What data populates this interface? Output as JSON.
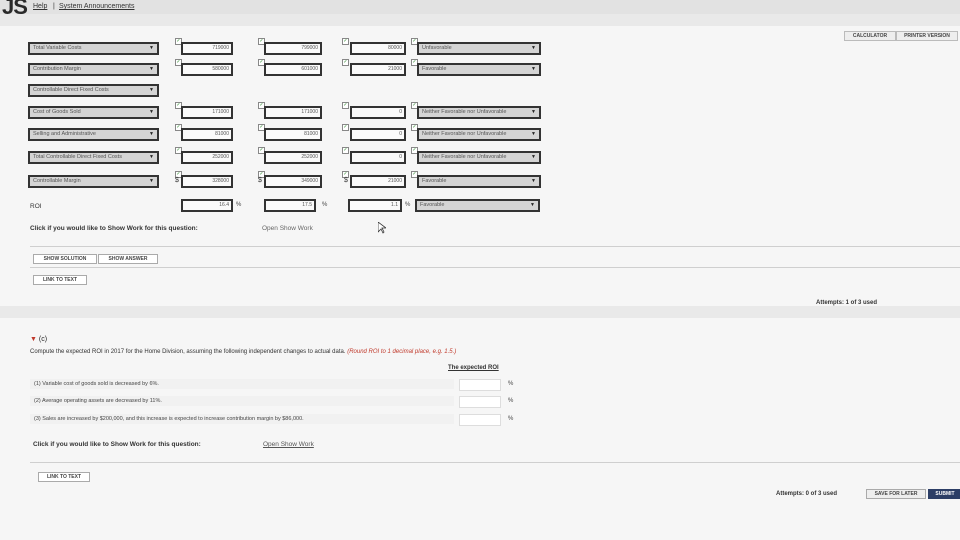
{
  "header": {
    "logo": "JS",
    "help_link": "Help",
    "separator": "|",
    "announcements_link": "System Announcements",
    "calculator_button": "CALCULATOR",
    "printer_button": "PRINTER VERSION"
  },
  "table": {
    "rows": [
      {
        "label": "Total Variable Costs",
        "v1": "719000",
        "v2": "799000",
        "v3": "80000",
        "status": "Unfavorable"
      },
      {
        "label": "Contribution Margin",
        "v1": "580000",
        "v2": "601000",
        "v3": "21000",
        "status": "Favorable"
      },
      {
        "label": "Controllable Direct Fixed Costs"
      },
      {
        "label": "Cost of Goods Sold",
        "v1": "171000",
        "v2": "171000",
        "v3": "0",
        "status": "Neither Favorable nor Unfavorable"
      },
      {
        "label": "Selling and Administrative",
        "v1": "81000",
        "v2": "81000",
        "v3": "0",
        "status": "Neither Favorable nor Unfavorable"
      },
      {
        "label": "Total Controllable Direct Fixed Costs",
        "v1": "252000",
        "v2": "252000",
        "v3": "0",
        "status": "Neither Favorable nor Unfavorable"
      },
      {
        "label": "Controllable Margin",
        "v1": "328000",
        "v2": "349000",
        "v3": "21000",
        "status": "Favorable"
      }
    ],
    "roi": {
      "label": "ROI",
      "v1": "16.4",
      "v2": "17.5",
      "v3": "1.1",
      "status": "Favorable"
    },
    "dollar": "$",
    "percent": "%"
  },
  "part_b": {
    "show_work_prompt": "Click if you would like to Show Work for this question:",
    "show_work_link": "Open Show Work",
    "show_solution": "SHOW SOLUTION",
    "show_answer": "SHOW ANSWER",
    "link_to_text": "LINK TO TEXT",
    "attempts": "Attempts: 1 of 3 used"
  },
  "part_c": {
    "toggle": "(c)",
    "instruction": "Compute the expected ROI in 2017 for the Home Division, assuming the following independent changes to actual data.",
    "rounding_note": "(Round ROI to 1 decimal place, e.g. 1.5.)",
    "column_header": "The expected ROI",
    "items": [
      {
        "text": "(1)  Variable cost of goods sold is decreased by 6%.",
        "unit": "%"
      },
      {
        "text": "(2)  Average operating assets are decreased by 11%.",
        "unit": "%"
      },
      {
        "text": "(3)  Sales are increased by $200,000, and this increase is expected to increase contribution margin by $86,000.",
        "unit": "%"
      }
    ],
    "show_work_prompt": "Click if you would like to Show Work for this question:",
    "show_work_link": "Open Show Work",
    "link_to_text": "LINK TO TEXT",
    "attempts": "Attempts: 0 of 3 used",
    "save_button": "SAVE FOR LATER",
    "submit_button": "SUBMIT"
  }
}
